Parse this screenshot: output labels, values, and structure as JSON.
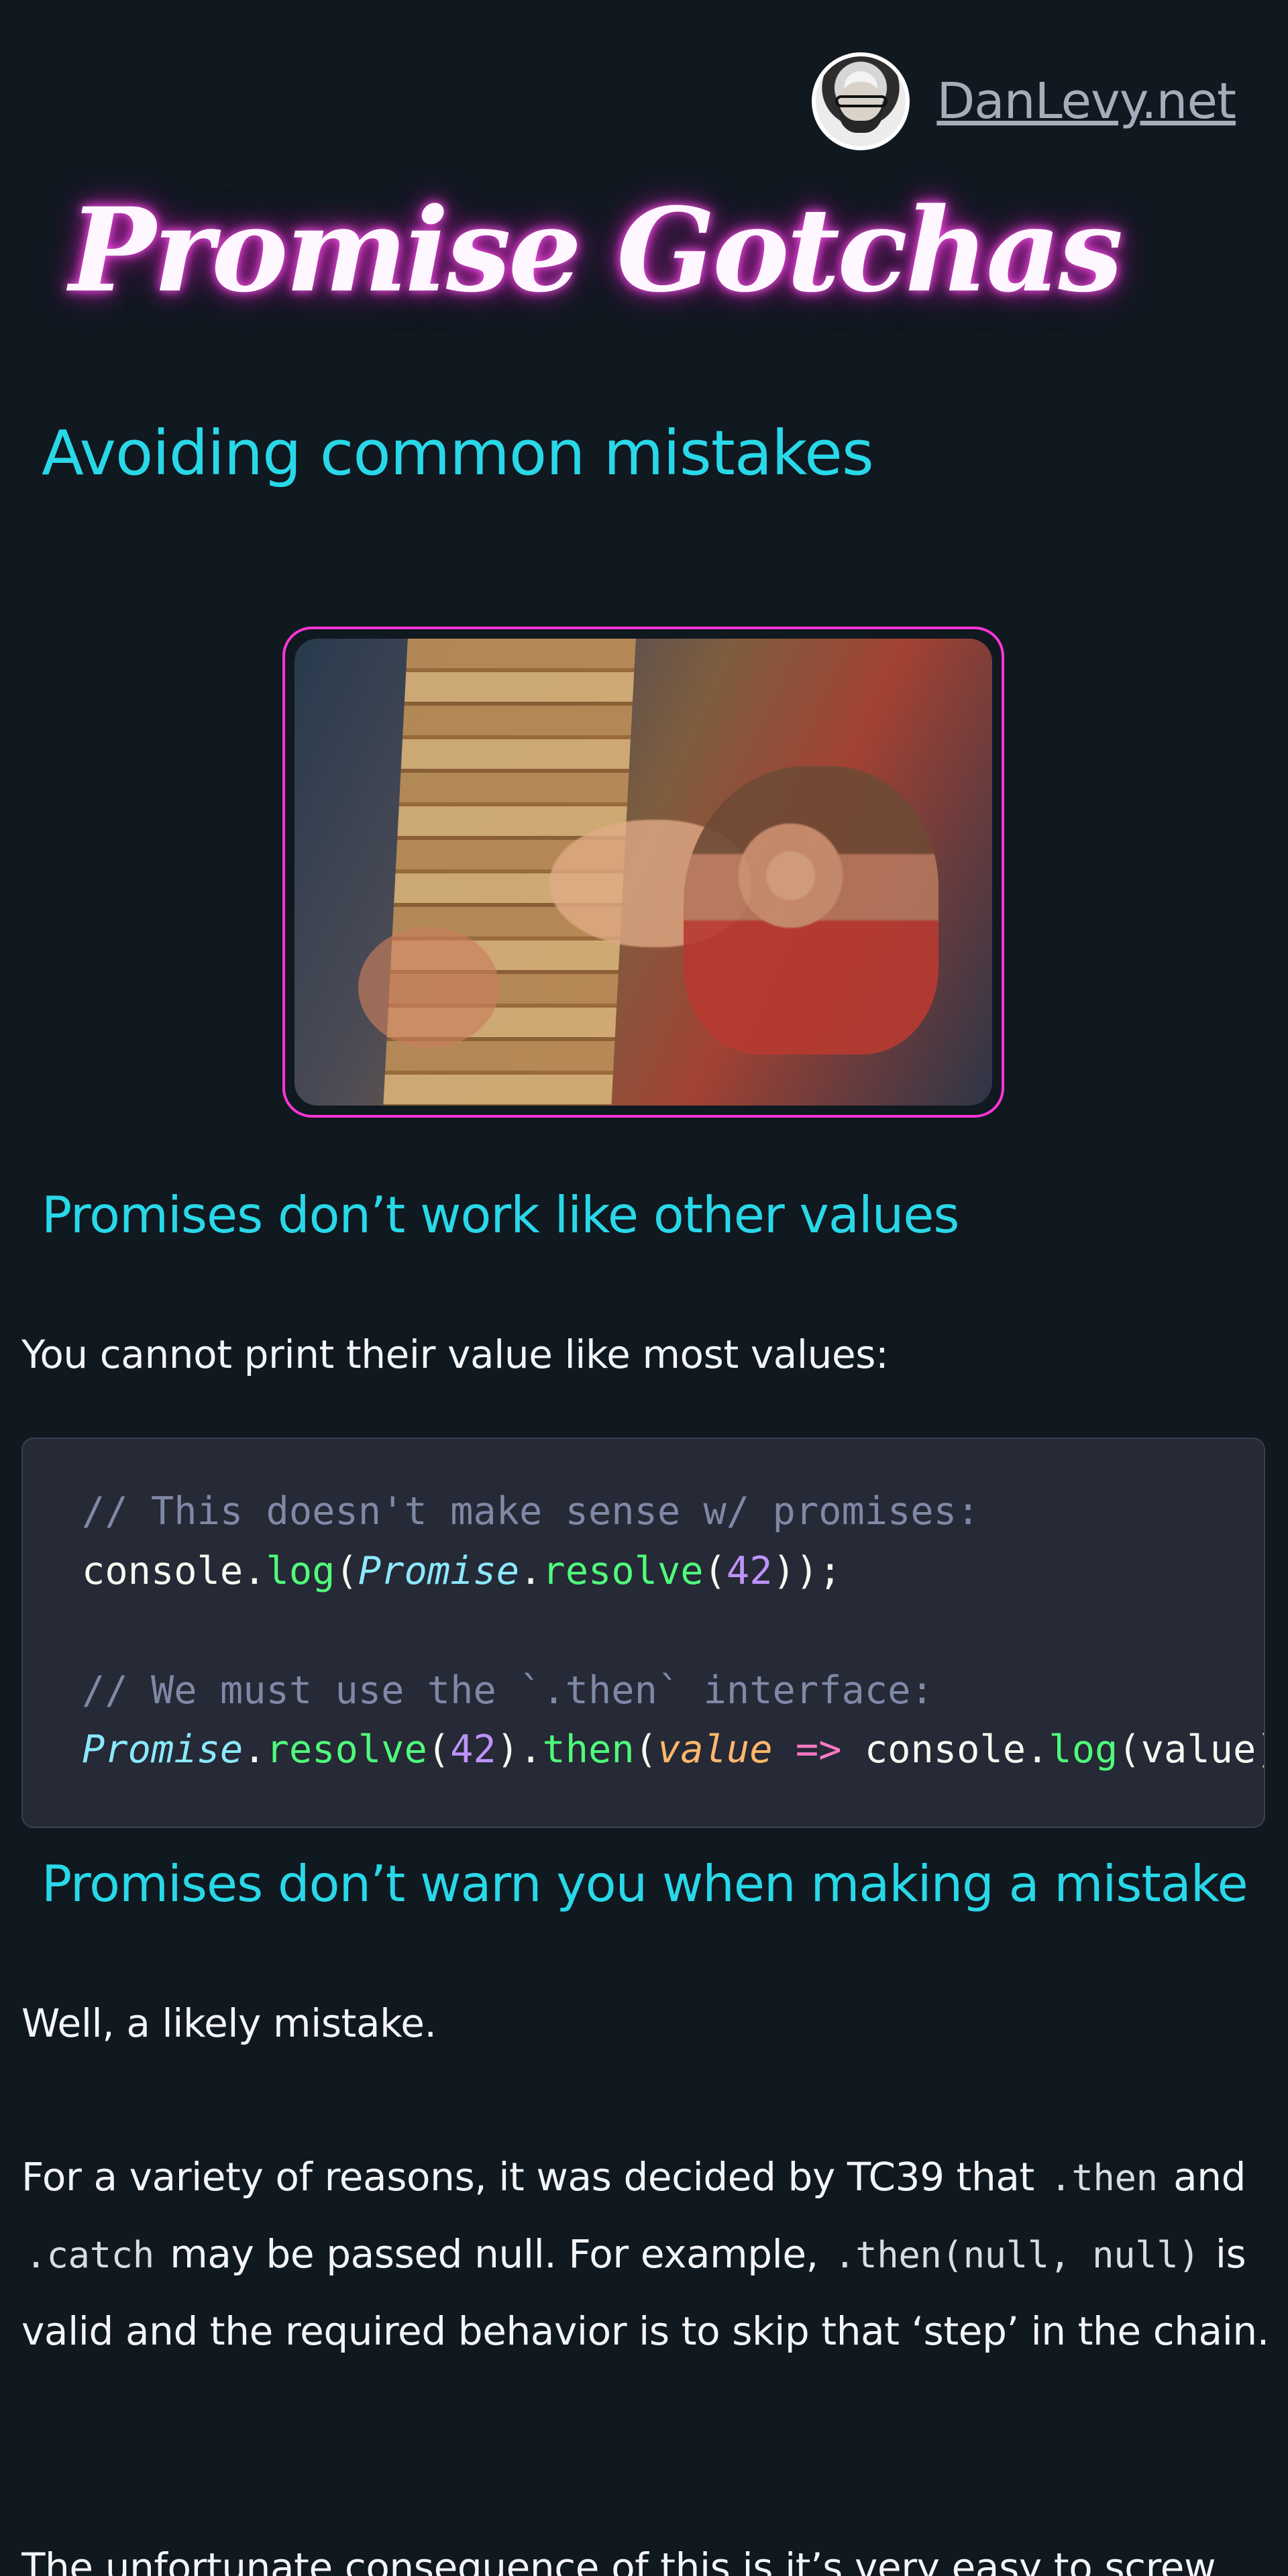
{
  "header": {
    "site_name": "DanLevy.net",
    "avatar_alt": "Dan Levy avatar"
  },
  "article": {
    "title": "Promise Gotchas",
    "subtitle": "Avoiding common mistakes",
    "sections": [
      {
        "heading": "Promises don’t work like other values",
        "paragraph": "You cannot print their value like most values:"
      },
      {
        "heading": "Promises don’t warn you when making a mistake",
        "paragraph_1": "Well, a likely mistake.",
        "paragraph_2": {
          "text_1": "For a variety of reasons, it was decided by TC39 that ",
          "code_1": ".then",
          "text_2": " and ",
          "code_2": ".catch",
          "text_3": " may be passed null. For example, ",
          "code_3": ".then(null, null)",
          "text_4": " is valid and the required behavior is to skip that ‘step’ in the chain."
        },
        "paragraph_3": "The unfortunate consequence of this is it’s very easy to screw"
      }
    ],
    "code_example": {
      "line_1": "// This doesn't make sense w/ promises:",
      "line_2": {
        "console": "console",
        "dot_1": ".",
        "log": "log",
        "open_1": "(",
        "promise": "Promise",
        "dot_2": ".",
        "resolve": "resolve",
        "open_2": "(",
        "number": "42",
        "close": "));"
      },
      "line_3": "// We must use the `.then` interface:",
      "line_4": {
        "promise": "Promise",
        "dot_1": ".",
        "resolve": "resolve",
        "open_1": "(",
        "number": "42",
        "close_1": ").",
        "then": "then",
        "open_2": "(",
        "param": "value",
        "arrow": " => ",
        "console": "console",
        "dot_2": ".",
        "log": "log",
        "open_3": "(",
        "arg": "value",
        "close_2": "));"
      }
    }
  },
  "image": {
    "subject": "child playing jenga tower"
  },
  "colors": {
    "background": "#101820",
    "accent_cyan": "#29d8e8",
    "neon_pink": "#ff35d7",
    "code_background": "#262936"
  }
}
